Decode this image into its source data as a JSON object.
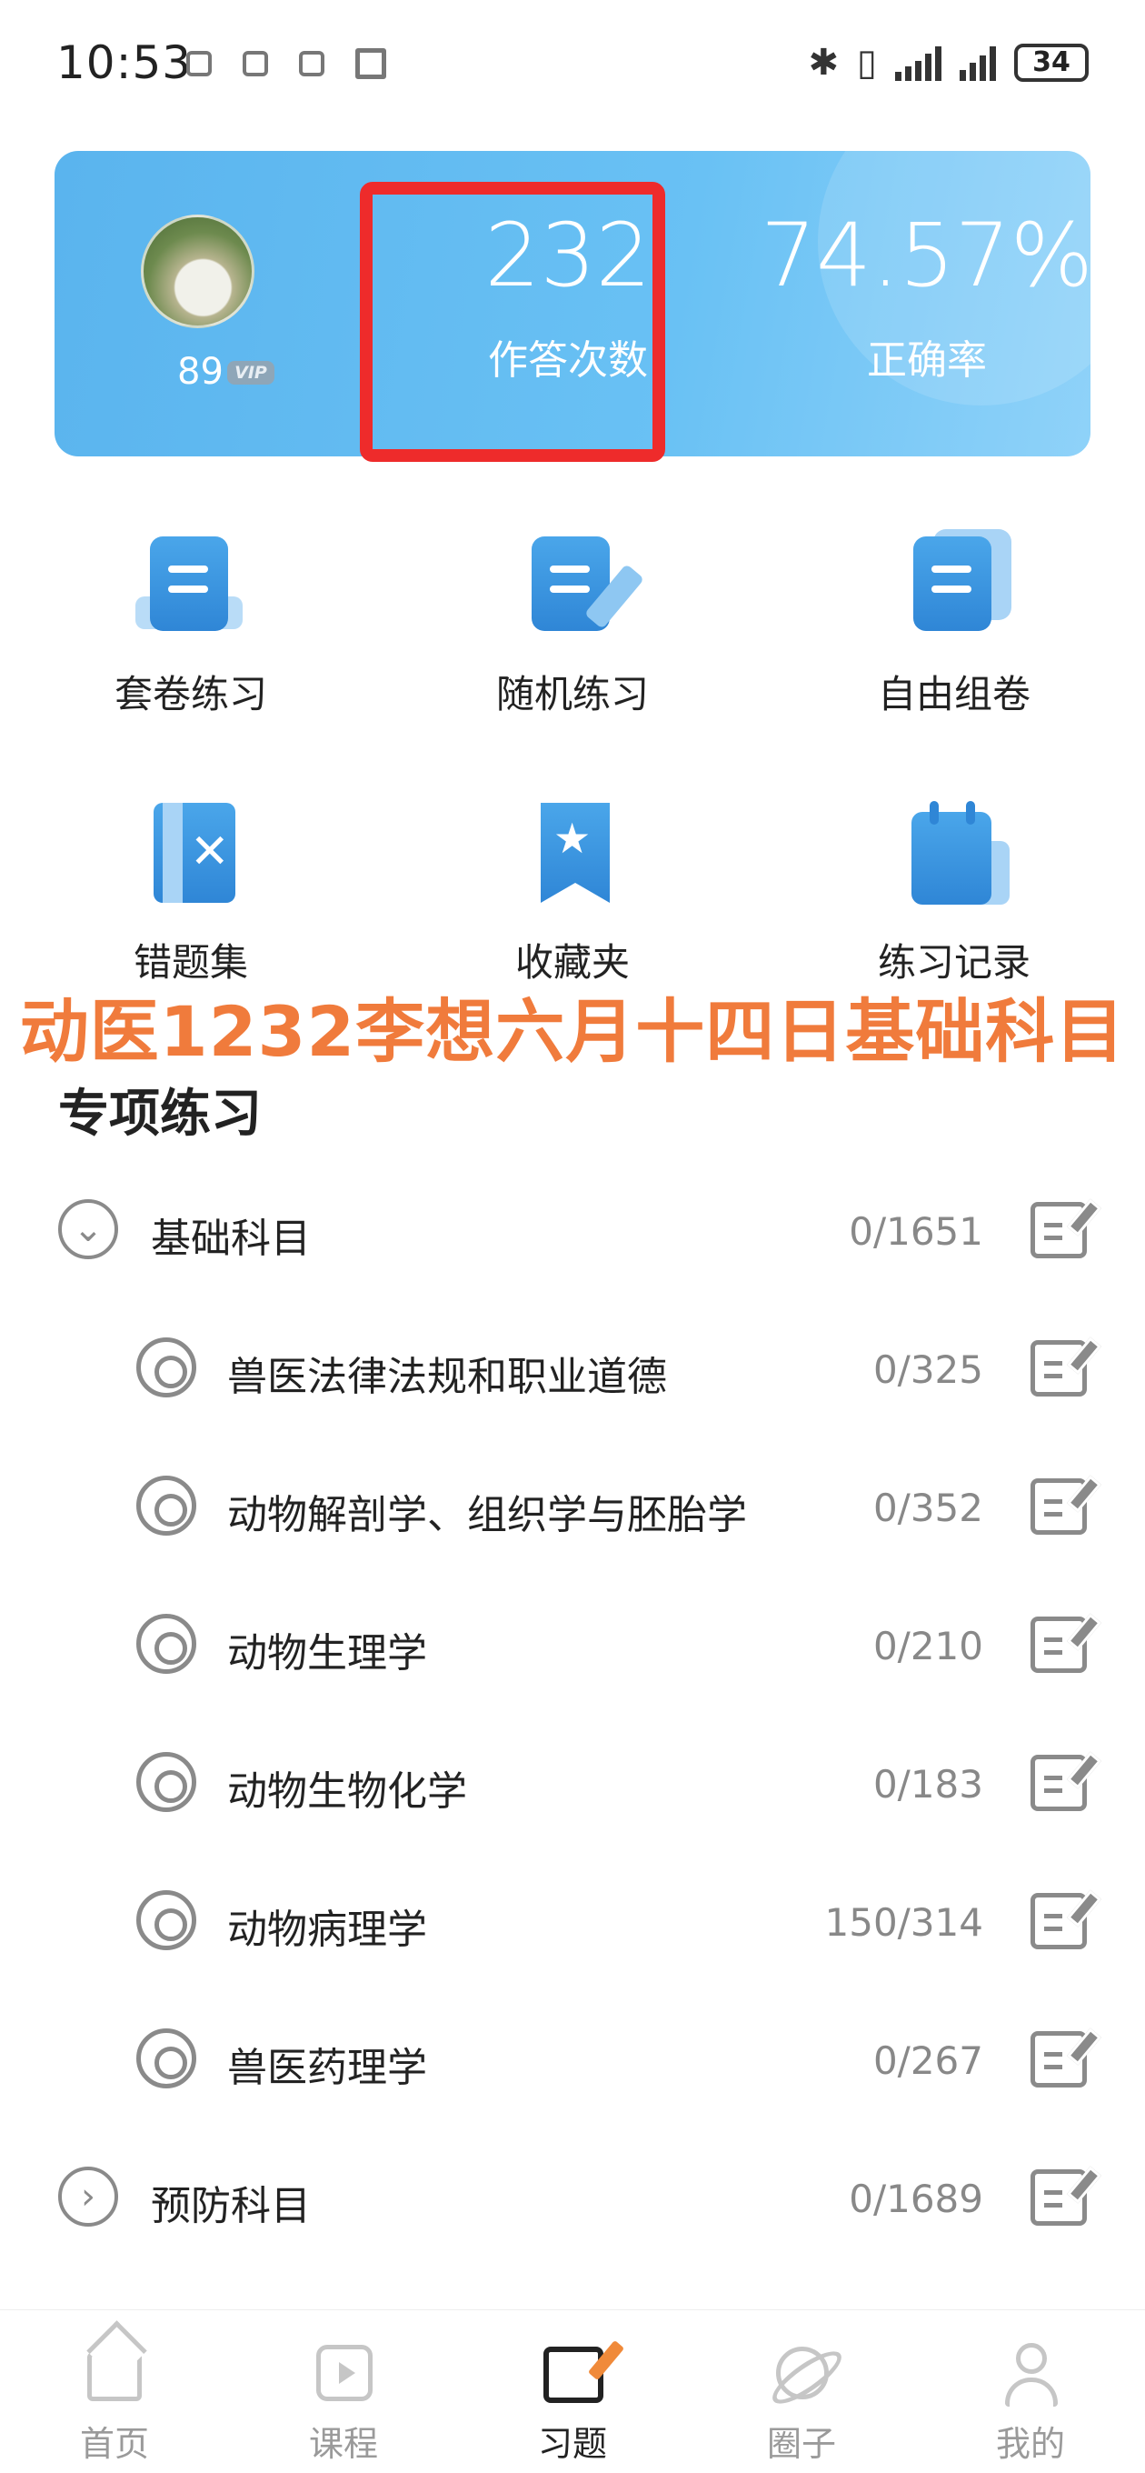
{
  "status_bar": {
    "time": "10:53",
    "battery": "34"
  },
  "hero": {
    "user_level": "89",
    "vip_badge": "VIP",
    "answer_count": "232",
    "answer_count_label": "作答次数",
    "accuracy": "74.57%",
    "accuracy_label": "正确率"
  },
  "features": [
    {
      "label": "套卷练习",
      "icon": "doc-icon"
    },
    {
      "label": "随机练习",
      "icon": "doc-edit-icon"
    },
    {
      "label": "自由组卷",
      "icon": "stacked-doc-icon"
    },
    {
      "label": "错题集",
      "icon": "wrong-book-icon"
    },
    {
      "label": "收藏夹",
      "icon": "bookmark-star-icon"
    },
    {
      "label": "练习记录",
      "icon": "calendar-record-icon"
    }
  ],
  "overlay_caption": "动医1232李想六月十四日基础科目",
  "section_title": "专项练习",
  "list": [
    {
      "label": "基础科目",
      "count": "0/1651",
      "expanded": true
    },
    {
      "label": "兽医法律法规和职业道德",
      "count": "0/325"
    },
    {
      "label": "动物解剖学、组织学与胚胎学",
      "count": "0/352"
    },
    {
      "label": "动物生理学",
      "count": "0/210"
    },
    {
      "label": "动物生物化学",
      "count": "0/183"
    },
    {
      "label": "动物病理学",
      "count": "150/314"
    },
    {
      "label": "兽医药理学",
      "count": "0/267"
    },
    {
      "label": "预防科目",
      "count": "0/1689",
      "expanded": false
    }
  ],
  "bottom_nav": [
    {
      "label": "首页",
      "icon": "home-icon"
    },
    {
      "label": "课程",
      "icon": "course-play-icon"
    },
    {
      "label": "习题",
      "icon": "exercise-edit-icon",
      "active": true
    },
    {
      "label": "圈子",
      "icon": "planet-icon"
    },
    {
      "label": "我的",
      "icon": "user-icon"
    }
  ],
  "colors": {
    "accent": "#5ab4ee",
    "highlight": "#ee2b2b",
    "overlay": "#f07b3c",
    "active_nav": "#f08a3a"
  }
}
